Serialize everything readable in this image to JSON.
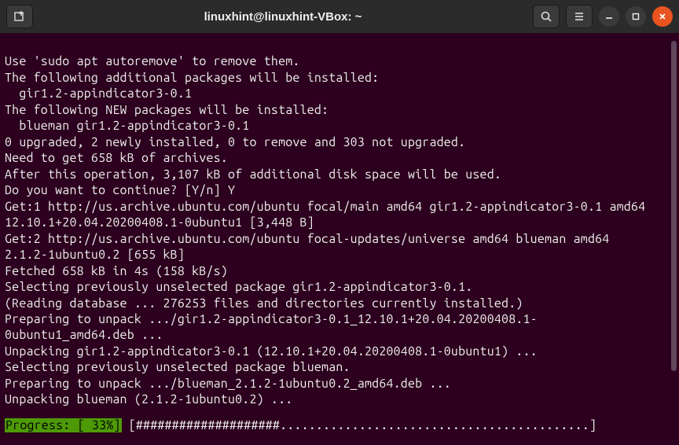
{
  "titlebar": {
    "title": "linuxhint@linuxhint-VBox: ~",
    "new_tab_icon": "new-tab",
    "search_icon": "search",
    "menu_icon": "menu",
    "minimize_icon": "minimize",
    "maximize_icon": "maximize",
    "close_icon": "close"
  },
  "terminal": {
    "lines": [
      "Use 'sudo apt autoremove' to remove them.",
      "The following additional packages will be installed:",
      "  gir1.2-appindicator3-0.1",
      "The following NEW packages will be installed:",
      "  blueman gir1.2-appindicator3-0.1",
      "0 upgraded, 2 newly installed, 0 to remove and 303 not upgraded.",
      "Need to get 658 kB of archives.",
      "After this operation, 3,107 kB of additional disk space will be used.",
      "Do you want to continue? [Y/n] Y",
      "Get:1 http://us.archive.ubuntu.com/ubuntu focal/main amd64 gir1.2-appindicator3-0.1 amd64 12.10.1+20.04.20200408.1-0ubuntu1 [3,448 B]",
      "Get:2 http://us.archive.ubuntu.com/ubuntu focal-updates/universe amd64 blueman amd64 2.1.2-1ubuntu0.2 [655 kB]",
      "Fetched 658 kB in 4s (158 kB/s)",
      "Selecting previously unselected package gir1.2-appindicator3-0.1.",
      "(Reading database ... 276253 files and directories currently installed.)",
      "Preparing to unpack .../gir1.2-appindicator3-0.1_12.10.1+20.04.20200408.1-0ubuntu1_amd64.deb ...",
      "Unpacking gir1.2-appindicator3-0.1 (12.10.1+20.04.20200408.1-0ubuntu1) ...",
      "Selecting previously unselected package blueman.",
      "Preparing to unpack .../blueman_2.1.2-1ubuntu0.2_amd64.deb ...",
      "Unpacking blueman (2.1.2-1ubuntu0.2) ..."
    ],
    "progress_label": "Progress: [ 33%]",
    "progress_bar": " [####################...........................................] "
  }
}
